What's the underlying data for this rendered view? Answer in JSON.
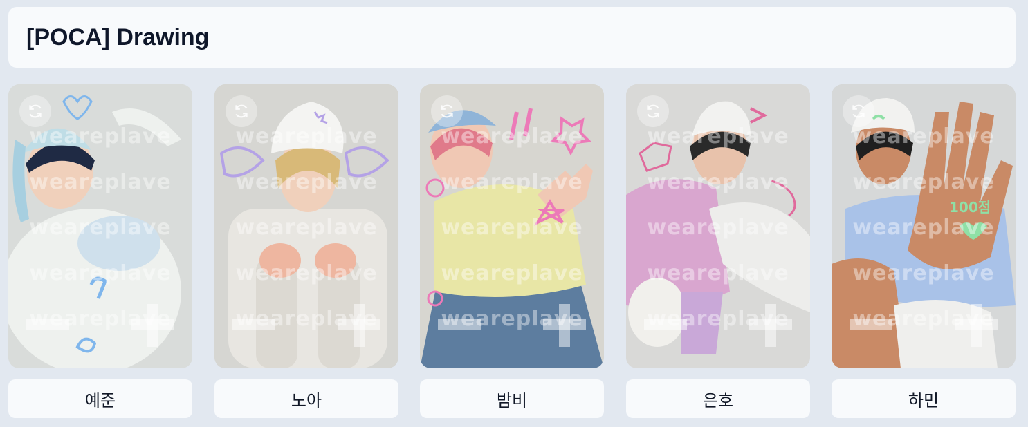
{
  "header": {
    "title": "[POCA] Drawing"
  },
  "watermark": "weareplave",
  "cards": [
    {
      "name": "예준",
      "palette": {
        "bg": "#d9dcda",
        "hat": "#bfdde6",
        "outfit": "#eef1ee",
        "hair": "#1f2a44",
        "doodle": "#7fb6ec"
      }
    },
    {
      "name": "노아",
      "palette": {
        "bg": "#d6d6d2",
        "hat": "#f4f4f2",
        "outfit": "#e8e6e1",
        "hair": "#d8b978",
        "doodle": "#b4a2e6"
      }
    },
    {
      "name": "밤비",
      "palette": {
        "bg": "#d7d6d0",
        "hat": "#8fb4d8",
        "outfit": "#e8e6a6",
        "hair": "#e07a8a",
        "doodle": "#ec7ab8"
      }
    },
    {
      "name": "은호",
      "palette": {
        "bg": "#d9d9d7",
        "hat": "#f2f2f0",
        "outfit": "#d9a6cf",
        "hair": "#2a2a2a",
        "doodle": "#e06a9c"
      }
    },
    {
      "name": "하민",
      "palette": {
        "bg": "#d6d8d8",
        "hat": "#f2f2f0",
        "outfit": "#a9c2e8",
        "hair": "#1f1f1f",
        "doodle": "#8fe0a6"
      }
    }
  ]
}
